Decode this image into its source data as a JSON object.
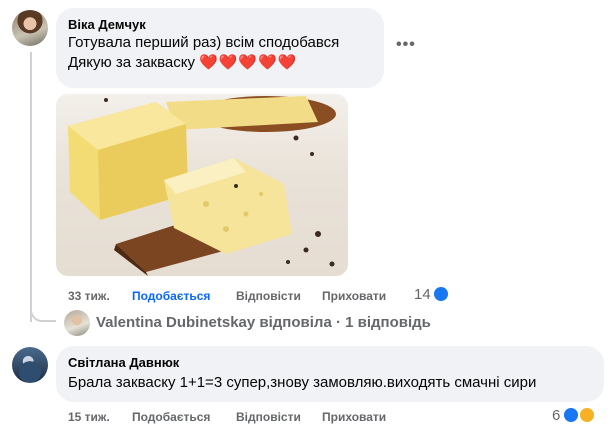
{
  "comments": [
    {
      "author": "Віка Демчук",
      "lines": [
        "Готувала перший раз) всім сподобався",
        "Дякую за закваску"
      ],
      "emoji": "❤️❤️❤️❤️❤️",
      "time": "33 тиж.",
      "like": "Подобається",
      "reply": "Відповісти",
      "hide": "Приховати",
      "reaction_count": "14",
      "reactions": [
        "like-icon"
      ]
    },
    {
      "author": "Світлана Давнюк",
      "lines": [
        "Брала закваску 1+1=3 супер,знову замовляю.виходять смачні сири"
      ],
      "time": "15 тиж.",
      "like": "Подобається",
      "reply": "Відповісти",
      "hide": "Приховати",
      "reaction_count": "6",
      "reactions": [
        "like-icon",
        "haha-icon"
      ]
    }
  ],
  "replies_summary": "Valentina Dubinetskay відповіла · 1 відповідь",
  "more_icon": "more-dots-icon",
  "colors": {
    "link": "#0866ff",
    "muted": "#65676b",
    "bubble": "#f0f2f5",
    "like": "#1877f2"
  }
}
